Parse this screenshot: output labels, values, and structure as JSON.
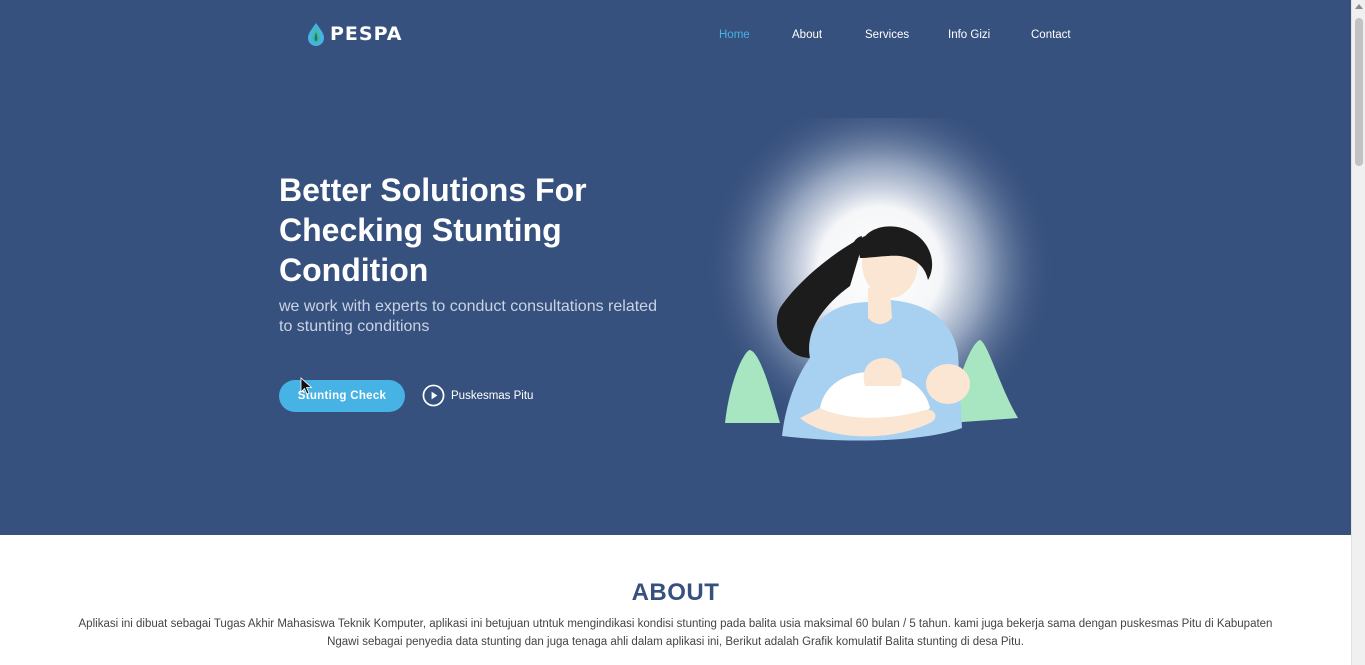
{
  "brand": {
    "name": "PESPA",
    "icon": "water-drop-icon"
  },
  "nav": {
    "items": [
      {
        "label": "Home",
        "active": true
      },
      {
        "label": "About",
        "active": false
      },
      {
        "label": "Services",
        "active": false
      },
      {
        "label": "Info Gizi",
        "active": false
      },
      {
        "label": "Contact",
        "active": false
      }
    ]
  },
  "hero": {
    "title": "Better Solutions For Checking Stunting Condition",
    "subtitle": "we work with experts to conduct consultations related to stunting conditions",
    "primary_button": "Stunting Check",
    "video_link": "Puskesmas Pitu",
    "video_icon": "play-circle-icon",
    "illustration": "mother-nursing-baby-illustration"
  },
  "about": {
    "title": "ABOUT",
    "text": "Aplikasi ini dibuat sebagai Tugas Akhir Mahasiswa Teknik Komputer, aplikasi ini betujuan utntuk mengindikasi kondisi stunting pada balita usia maksimal 60 bulan / 5 tahun. kami juga bekerja sama dengan puskesmas Pitu di Kabupaten Ngawi sebagai penyedia data stunting dan juga tenaga ahli dalam aplikasi ini, Berikut adalah Grafik komulatif Balita stunting di desa Pitu."
  },
  "colors": {
    "hero_bg": "#37517e",
    "accent": "#47b2e4",
    "white": "#ffffff",
    "about_title": "#37517e"
  }
}
